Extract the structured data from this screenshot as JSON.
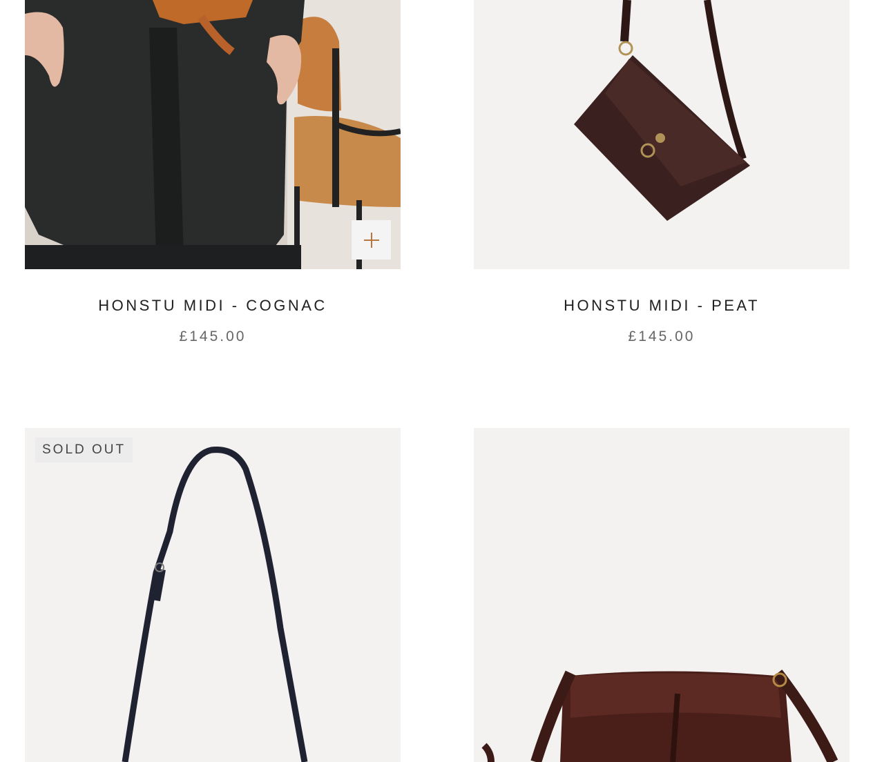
{
  "products": [
    {
      "title": "HONSTU MIDI - COGNAC",
      "price": "£145.00",
      "quick_add_icon": "plus-icon"
    },
    {
      "title": "HONSTU MIDI - PEAT",
      "price": "£145.00"
    },
    {
      "badge": "SOLD OUT"
    },
    {}
  ],
  "colors": {
    "accent": "#b8763f",
    "image_bg": "#f4f1f1",
    "text": "#1f1f1f",
    "price": "#666666"
  }
}
